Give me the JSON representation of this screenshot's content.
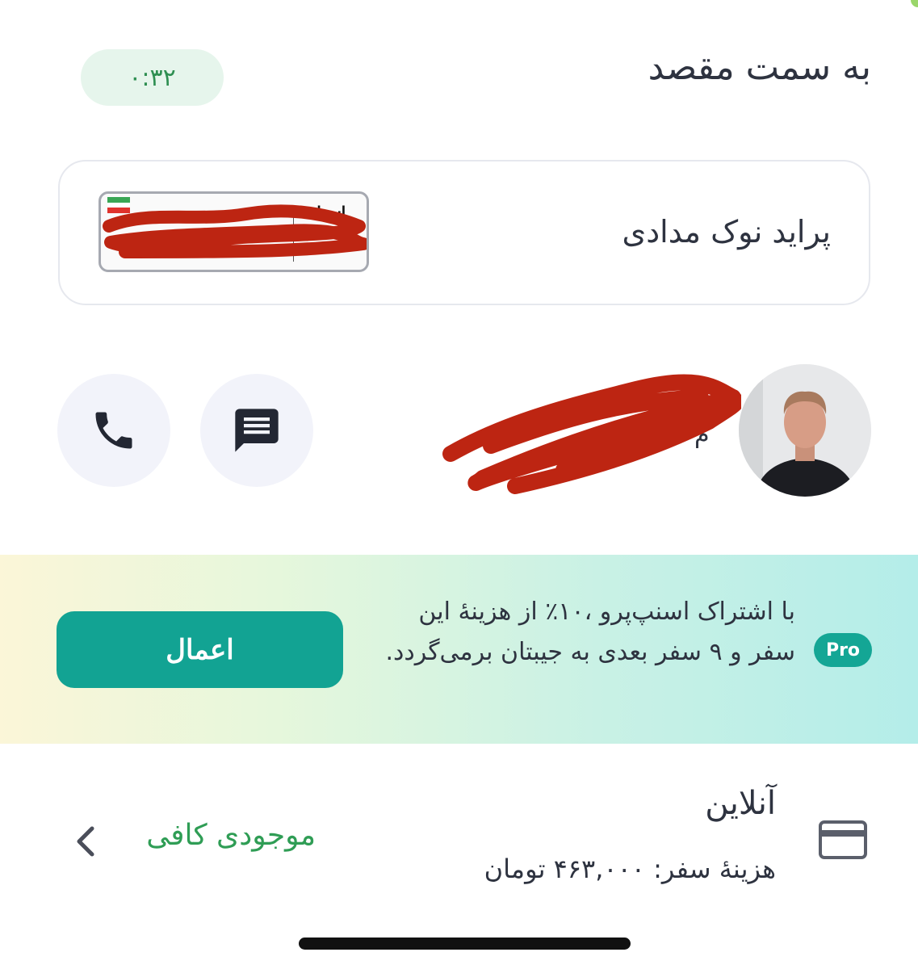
{
  "header": {
    "title": "به سمت مقصد",
    "timer": "۰:۳۲"
  },
  "vehicle": {
    "name": "پراید نوک مدادی",
    "plate_country": "ایــران"
  },
  "driver": {
    "call_icon": "phone-icon",
    "message_icon": "chat-icon"
  },
  "promo": {
    "badge": "Pro",
    "text": "با اشتراک اسنپ‌پرو ،۱۰٪ از هزینهٔ این سفر و ۹ سفر بعدی به جیبتان برمی‌گردد.",
    "apply_label": "اعمال",
    "accent_color": "#12a393"
  },
  "payment": {
    "method": "آنلاین",
    "cost": "هزینهٔ سفر: ۴۶۳,۰۰۰ تومان",
    "balance_status": "موجودی کافی",
    "card_icon": "credit-card-icon",
    "chevron_icon": "chevron-left-icon"
  },
  "colors": {
    "success_green": "#2f9d55",
    "text_dark": "#2e3340"
  }
}
